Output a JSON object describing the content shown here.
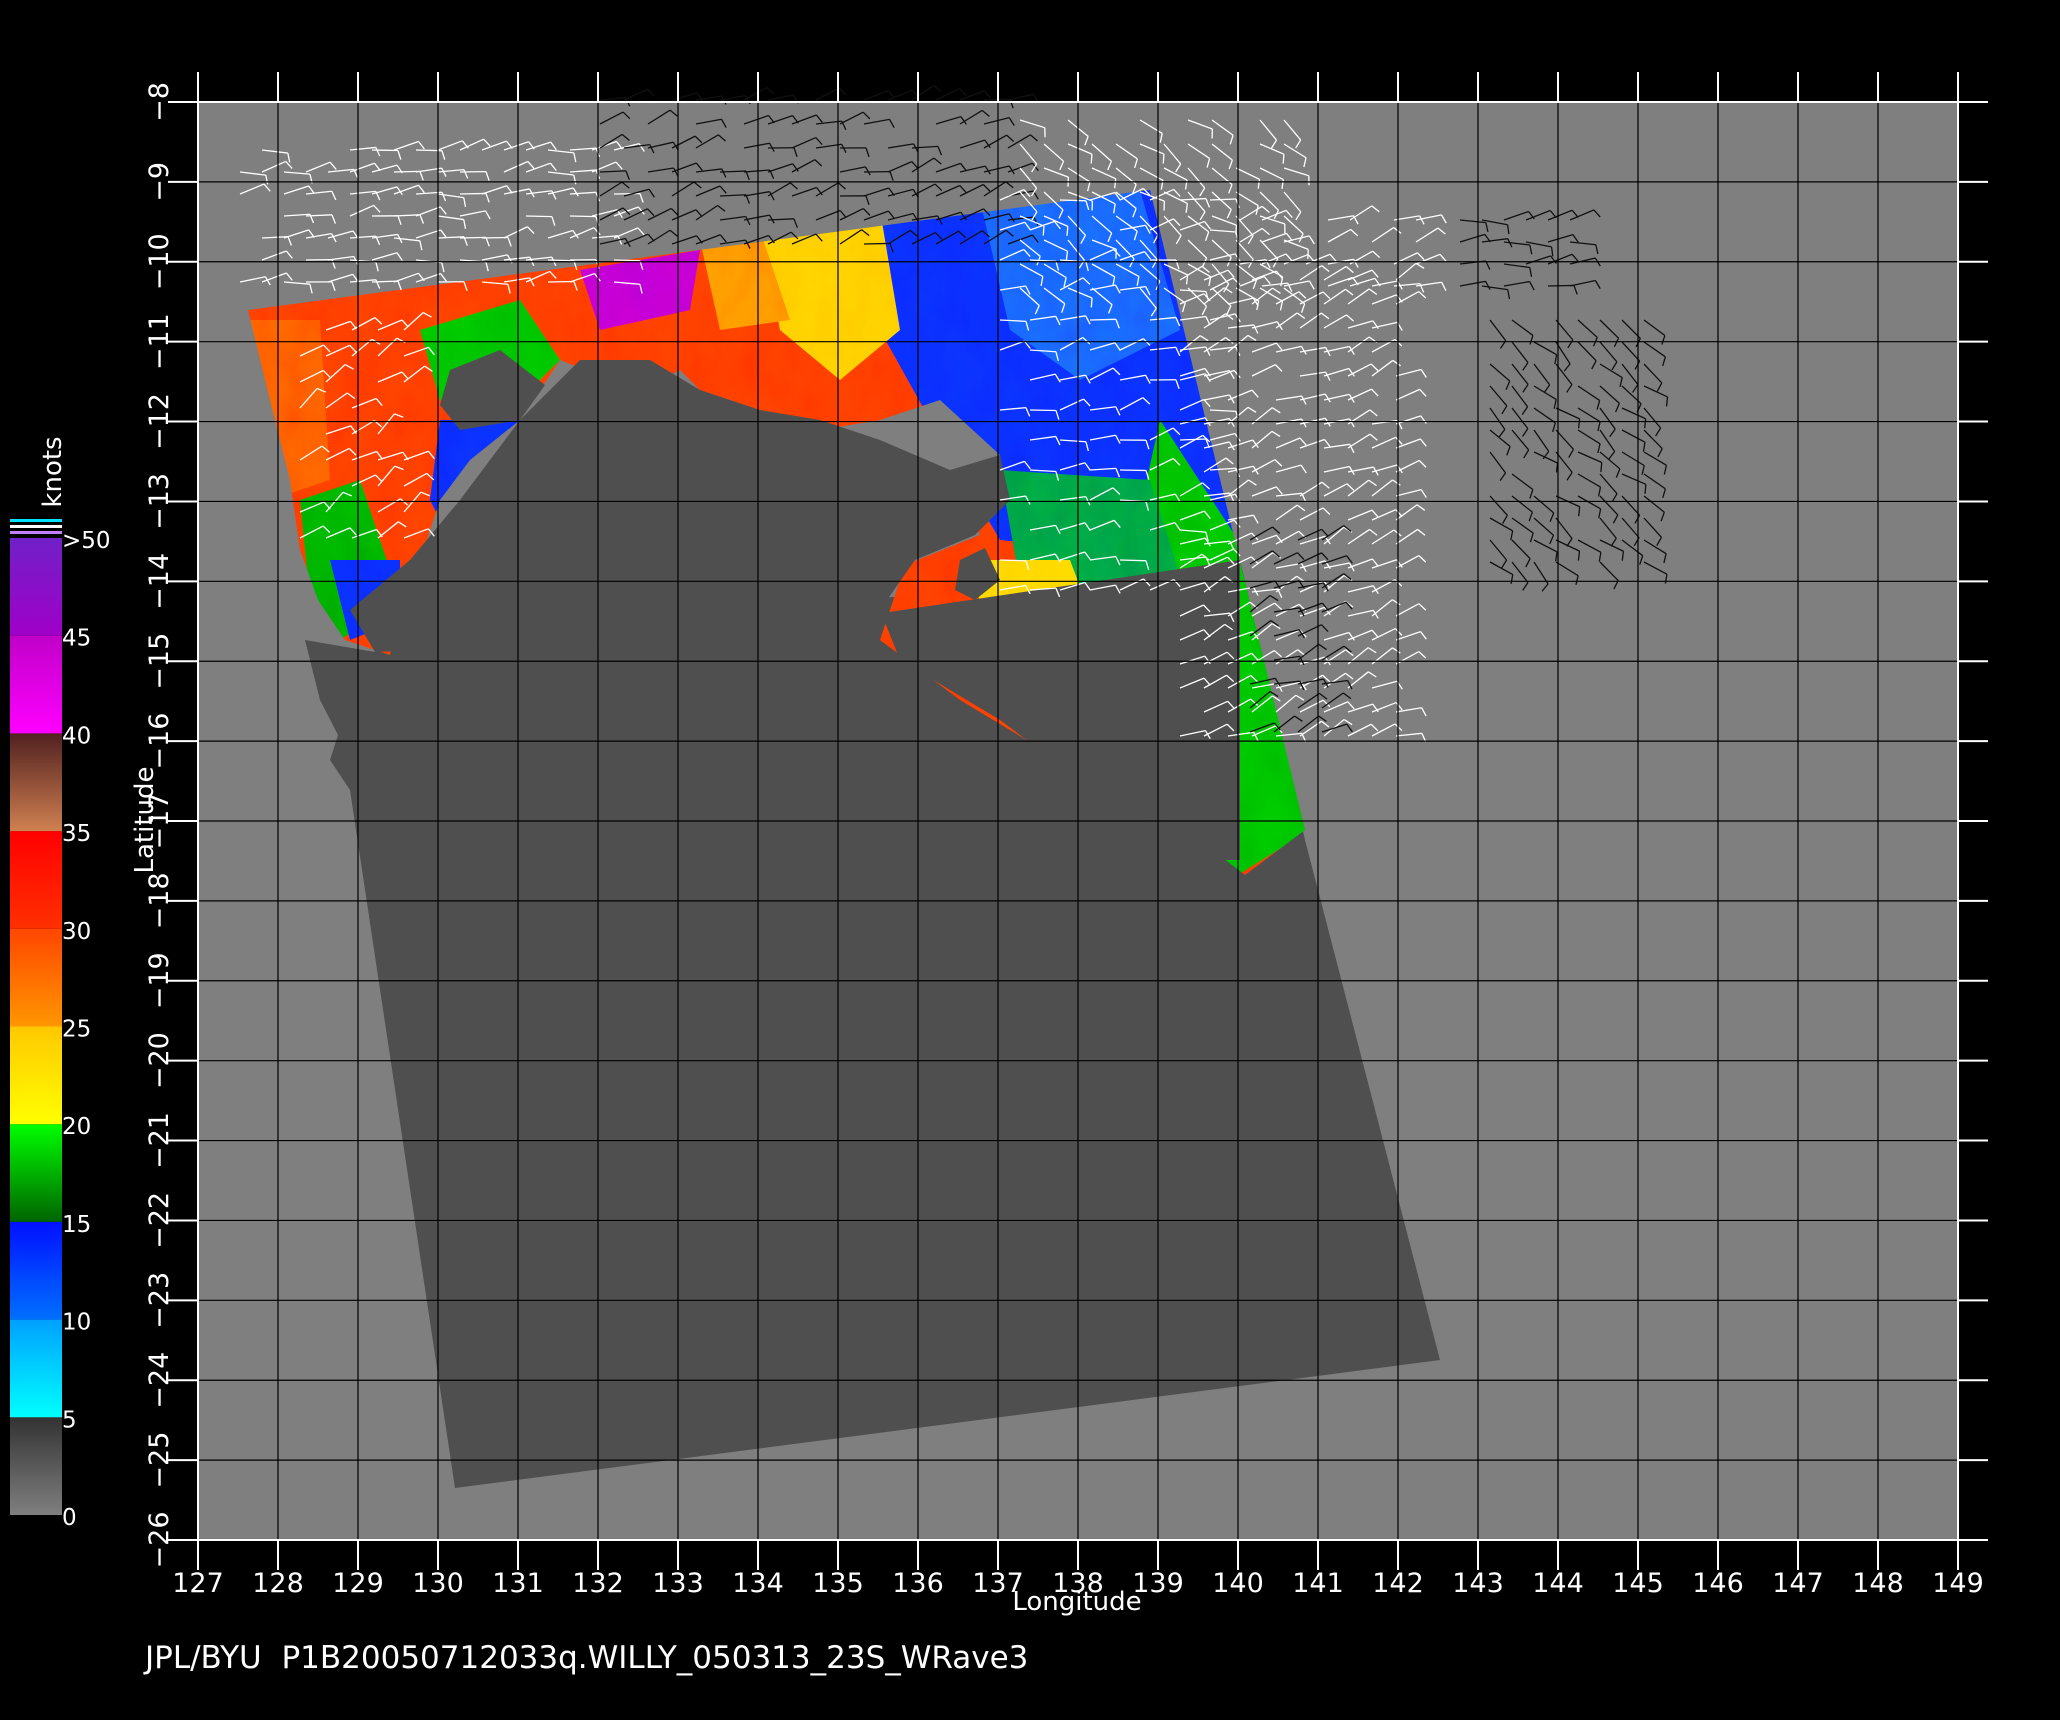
{
  "map": {
    "x_axis_label": "Longitude",
    "y_axis_label": "Latitude",
    "x_ticks": [
      "127",
      "128",
      "129",
      "130",
      "131",
      "132",
      "133",
      "134",
      "135",
      "136",
      "137",
      "138",
      "139",
      "140",
      "141",
      "142",
      "143",
      "144",
      "145",
      "146",
      "147",
      "148",
      "149"
    ],
    "y_ticks": [
      "-8",
      "-9",
      "-10",
      "-11",
      "-12",
      "-13",
      "-14",
      "-15",
      "-16",
      "-17",
      "-18",
      "-19",
      "-20",
      "-21",
      "-22",
      "-23",
      "-24",
      "-25",
      "-26"
    ],
    "lon_range": [
      127,
      149
    ],
    "lat_range": [
      -8,
      -26
    ],
    "background_color": "#000000",
    "ocean_color": "#7f7f7f",
    "land_swath_color": "#4f4f4f"
  },
  "legend": {
    "title": "knots",
    "labels": [
      ">50",
      "45",
      "40",
      "35",
      "30",
      "25",
      "20",
      "15",
      "10",
      "5",
      "0"
    ],
    "bands": [
      {
        "from": 0,
        "to": 5,
        "colors": [
          "#7f7f7f",
          "#333333"
        ]
      },
      {
        "from": 5,
        "to": 10,
        "colors": [
          "#00ffff",
          "#00a0ff"
        ]
      },
      {
        "from": 10,
        "to": 15,
        "colors": [
          "#0070ff",
          "#0010ff"
        ]
      },
      {
        "from": 15,
        "to": 20,
        "colors": [
          "#006400",
          "#00ff00"
        ]
      },
      {
        "from": 20,
        "to": 25,
        "colors": [
          "#ffff00",
          "#ffc800"
        ]
      },
      {
        "from": 25,
        "to": 30,
        "colors": [
          "#ff9600",
          "#ff4600"
        ]
      },
      {
        "from": 30,
        "to": 35,
        "colors": [
          "#ff3000",
          "#ff0000"
        ]
      },
      {
        "from": 35,
        "to": 40,
        "colors": [
          "#d08050",
          "#502020"
        ]
      },
      {
        "from": 40,
        "to": 45,
        "colors": [
          "#ff00ff",
          "#c000c8"
        ]
      },
      {
        "from": 45,
        "to": 50,
        "colors": [
          "#a000c8",
          "#7020c8"
        ]
      }
    ]
  },
  "footer": {
    "source": "JPL/BYU",
    "product_id": "P1B20050712033q.WILLY_050313_23S_WRave3"
  }
}
